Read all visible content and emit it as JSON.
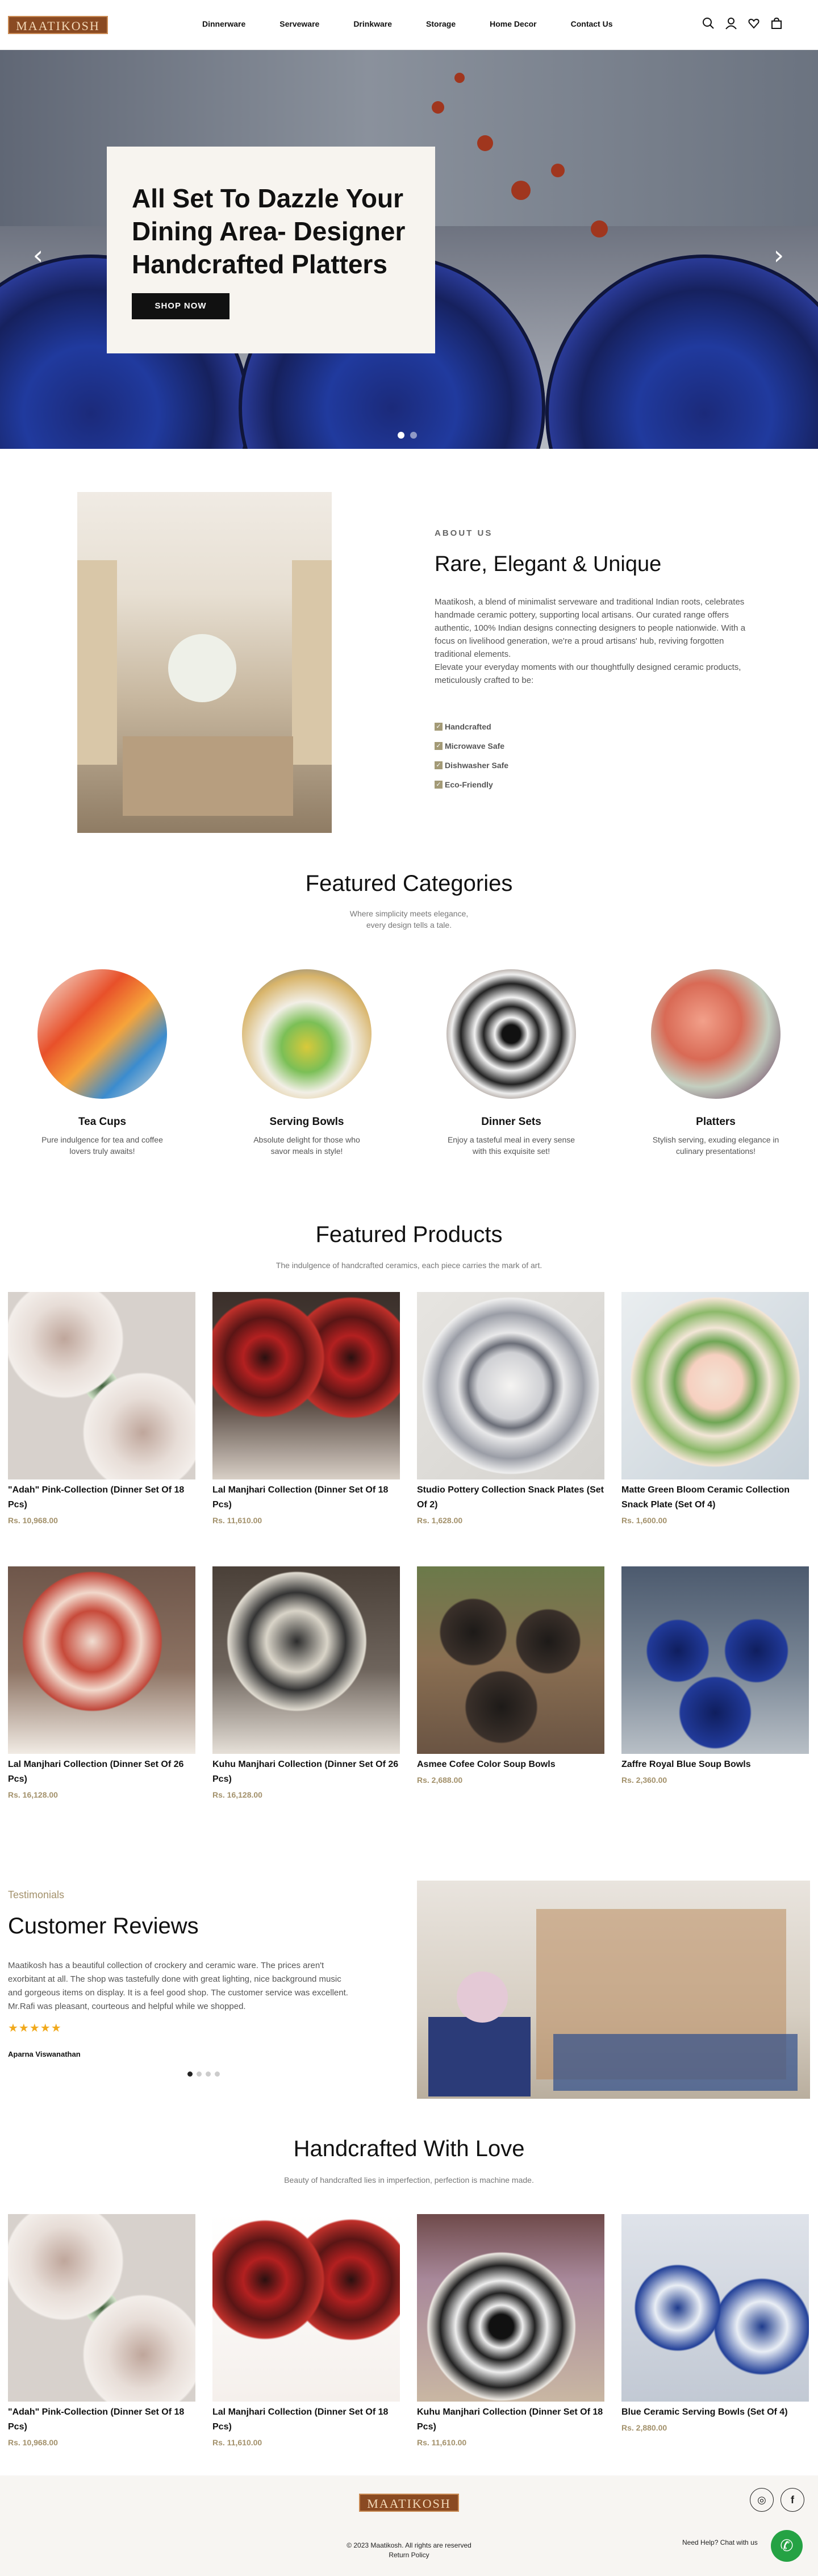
{
  "header": {
    "logo": "MAATIKOSH",
    "nav": [
      "Dinnerware",
      "Serveware",
      "Drinkware",
      "Storage",
      "Home Decor",
      "Contact Us"
    ],
    "icons": [
      "search-icon",
      "user-icon",
      "heart-icon",
      "bag-icon"
    ]
  },
  "hero": {
    "title": "All Set To Dazzle Your Dining Area- Designer Handcrafted Platters",
    "button": "SHOP NOW",
    "prev": "prev-arrow-icon",
    "next": "next-arrow-icon",
    "slides": 2,
    "active_slide": 1
  },
  "about": {
    "label": "ABOUT US",
    "title": "Rare, Elegant & Unique",
    "text": "Maatikosh, a blend of minimalist serveware and traditional Indian roots, celebrates handmade ceramic pottery, supporting local artisans. Our curated range offers authentic, 100% Indian designs connecting designers to people nationwide. With a focus on livelihood generation, we're a proud artisans' hub, reviving forgotten traditional elements.",
    "text2": "Elevate your everyday moments with our thoughtfully designed ceramic products, meticulously crafted to be:",
    "features": [
      "Handcrafted",
      "Microwave Safe",
      "Dishwasher Safe",
      "Eco-Friendly"
    ],
    "check_icon": "check-icon"
  },
  "categories": {
    "title": "Featured Categories",
    "subtitle_1": "Where simplicity meets elegance,",
    "subtitle_2": "every design tells a tale.",
    "items": [
      {
        "name": "Tea Cups",
        "desc_1": "Pure indulgence for tea and coffee",
        "desc_2": "lovers truly awaits!"
      },
      {
        "name": "Serving Bowls",
        "desc_1": "Absolute delight for those who",
        "desc_2": "savor meals in style!"
      },
      {
        "name": "Dinner Sets",
        "desc_1": "Enjoy a tasteful meal in every sense",
        "desc_2": "with this exquisite set!"
      },
      {
        "name": "Platters",
        "desc_1": "Stylish serving, exuding elegance in",
        "desc_2": "culinary presentations!"
      }
    ]
  },
  "featured": {
    "title": "Featured Products",
    "subtitle": "The indulgence of handcrafted ceramics, each piece carries the mark of art.",
    "products": [
      {
        "name": "\"Adah\" Pink-Collection (Dinner Set Of 18 Pcs)",
        "price": "Rs. 10,968.00"
      },
      {
        "name": "Lal Manjhari Collection (Dinner Set Of 18 Pcs)",
        "price": "Rs. 11,610.00"
      },
      {
        "name": "Studio Pottery Collection Snack Plates (Set Of 2)",
        "price": "Rs. 1,628.00"
      },
      {
        "name": "Matte Green Bloom Ceramic Collection Snack Plate (Set Of 4)",
        "price": "Rs. 1,600.00"
      },
      {
        "name": "Lal Manjhari Collection (Dinner Set Of 26 Pcs)",
        "price": "Rs. 16,128.00"
      },
      {
        "name": "Kuhu Manjhari Collection (Dinner Set Of 26 Pcs)",
        "price": "Rs. 16,128.00"
      },
      {
        "name": "Asmee Cofee Color Soup Bowls",
        "price": "Rs. 2,688.00"
      },
      {
        "name": "Zaffre Royal Blue Soup Bowls",
        "price": "Rs. 2,360.00"
      }
    ]
  },
  "reviews": {
    "label": "Testimonials",
    "title": "Customer Reviews",
    "text": "Maatikosh has a beautiful collection of crockery and ceramic ware. The prices aren't exorbitant at all. The shop was tastefully done with great lighting, nice background music and gorgeous items on display. It is a feel good shop. The customer service was excellent. Mr.Rafi was pleasant, courteous and helpful while we shopped.",
    "stars": "★★★★★",
    "rating": 5,
    "author": "Aparna Viswanathan",
    "dots": 4,
    "active_dot": 1
  },
  "handcrafted": {
    "title": "Handcrafted With Love",
    "subtitle": "Beauty of handcrafted lies in imperfection, perfection is machine made.",
    "products": [
      {
        "name": "\"Adah\" Pink-Collection (Dinner Set Of 18 Pcs)",
        "price": "Rs. 10,968.00"
      },
      {
        "name": "Lal Manjhari Collection (Dinner Set Of 18 Pcs)",
        "price": "Rs. 11,610.00"
      },
      {
        "name": "Kuhu Manjhari Collection (Dinner Set Of 18 Pcs)",
        "price": "Rs. 11,610.00"
      },
      {
        "name": "Blue Ceramic Serving Bowls (Set Of 4)",
        "price": "Rs. 2,880.00"
      }
    ]
  },
  "footer": {
    "logo": "MAATIKOSH",
    "copyright": "© 2023 Maatikosh. All rights are reserved",
    "policy": "Return Policy",
    "social": [
      "instagram-icon",
      "facebook-icon"
    ],
    "instagram_glyph": "◎",
    "facebook_glyph": "f",
    "help": "Need Help? Chat with us",
    "whatsapp_glyph": "✆"
  },
  "colors": {
    "brand": "#8a4a22",
    "price": "#a3916b",
    "star": "#f1a91c",
    "whatsapp": "#25a244"
  }
}
